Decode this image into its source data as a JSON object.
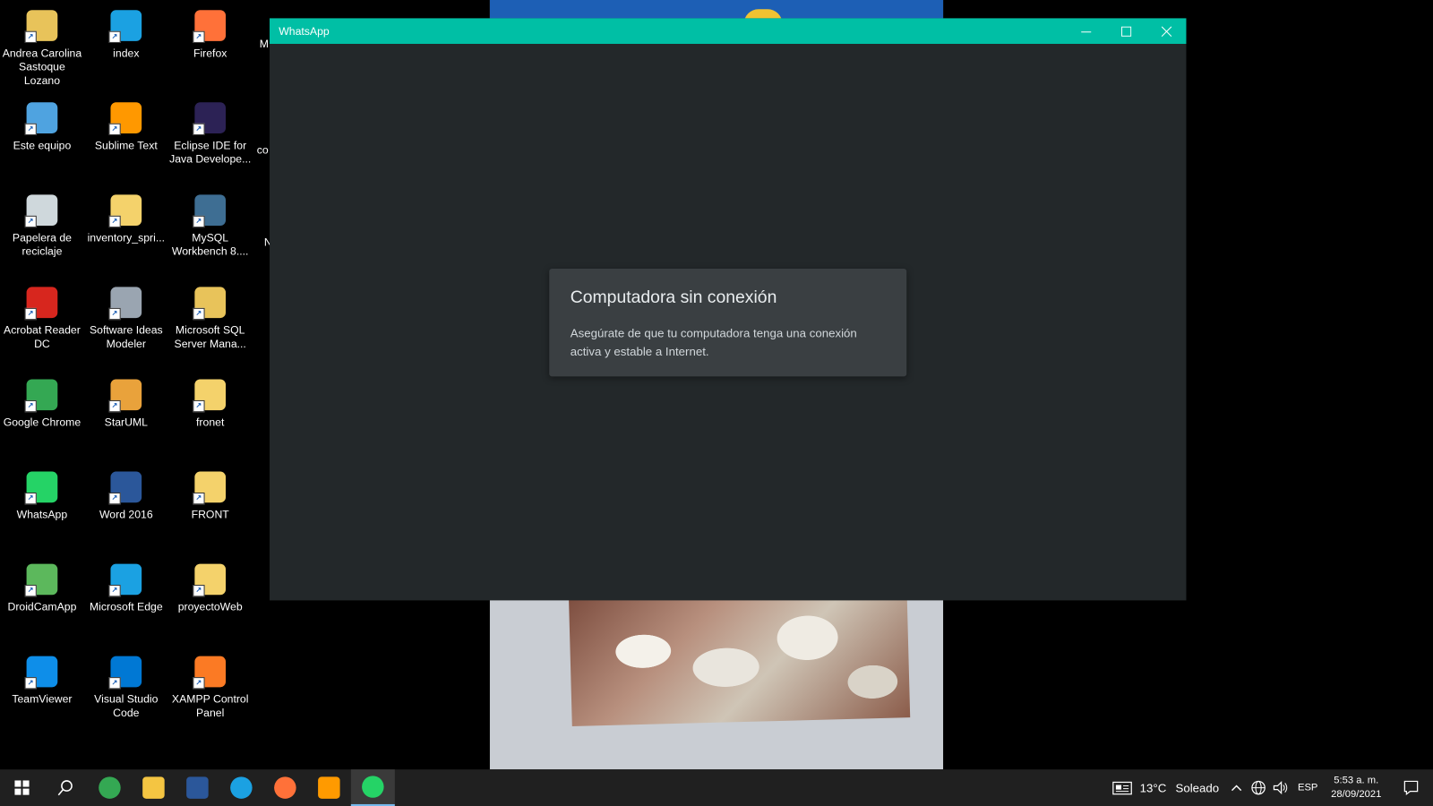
{
  "desktop": {
    "columns": [
      [
        {
          "label": "Andrea Carolina Sastoque Lozano",
          "icon": "user-folder-icon",
          "color": "#e8c35a"
        },
        {
          "label": "Este equipo",
          "icon": "computer-icon",
          "color": "#4fa3e0"
        },
        {
          "label": "Papelera de reciclaje",
          "icon": "recycle-bin-icon",
          "color": "#cfd8dc"
        },
        {
          "label": "Acrobat Reader DC",
          "icon": "acrobat-icon",
          "color": "#d7261e"
        },
        {
          "label": "Google Chrome",
          "icon": "chrome-icon",
          "color": "#34a853"
        },
        {
          "label": "WhatsApp",
          "icon": "whatsapp-icon",
          "color": "#25d366"
        },
        {
          "label": "DroidCamApp",
          "icon": "droidcam-icon",
          "color": "#5cb85c"
        },
        {
          "label": "TeamViewer",
          "icon": "teamviewer-icon",
          "color": "#0e8ee9"
        }
      ],
      [
        {
          "label": "index",
          "icon": "edge-icon",
          "color": "#1ba1e2"
        },
        {
          "label": "Sublime Text",
          "icon": "sublime-icon",
          "color": "#ff9800"
        },
        {
          "label": "inventory_spri...",
          "icon": "folder-icon",
          "color": "#f4d26b"
        },
        {
          "label": "Software Ideas Modeler",
          "icon": "modeler-icon",
          "color": "#9aa5b1"
        },
        {
          "label": "StarUML",
          "icon": "staruml-icon",
          "color": "#e9a23b"
        },
        {
          "label": "Word 2016",
          "icon": "word-icon",
          "color": "#2b579a"
        },
        {
          "label": "Microsoft Edge",
          "icon": "edge-icon",
          "color": "#1ba1e2"
        },
        {
          "label": "Visual Studio Code",
          "icon": "vscode-icon",
          "color": "#0078d4"
        }
      ],
      [
        {
          "label": "Firefox",
          "icon": "firefox-icon",
          "color": "#ff7139"
        },
        {
          "label": "Eclipse IDE for Java Develope...",
          "icon": "eclipse-icon",
          "color": "#2c2255"
        },
        {
          "label": "MySQL Workbench 8....",
          "icon": "mysql-icon",
          "color": "#3e6e93"
        },
        {
          "label": "Microsoft SQL Server Mana...",
          "icon": "sql-server-icon",
          "color": "#e8c35a"
        },
        {
          "label": "fronet",
          "icon": "vscode-folder-icon",
          "color": "#f4d26b"
        },
        {
          "label": "FRONT",
          "icon": "vscode-folder-icon",
          "color": "#f4d26b"
        },
        {
          "label": "proyectoWeb",
          "icon": "folder-icon",
          "color": "#f4d26b"
        },
        {
          "label": "XAMPP Control Panel",
          "icon": "xampp-icon",
          "color": "#fb7a24"
        }
      ]
    ],
    "partial_labels": [
      "M",
      "co",
      "N"
    ]
  },
  "whatsapp_window": {
    "title": "WhatsApp",
    "accent": "#00bfa5",
    "background": "#23282a",
    "offline_card": {
      "heading": "Computadora sin conexión",
      "message": "Asegúrate de que tu computadora tenga una conexión activa y estable a Internet."
    }
  },
  "taskbar": {
    "apps": [
      {
        "name": "chrome",
        "icon": "chrome-icon",
        "color": "#34a853"
      },
      {
        "name": "explorer",
        "icon": "folder-icon",
        "color": "#f4c542"
      },
      {
        "name": "word",
        "icon": "word-icon",
        "color": "#2b579a"
      },
      {
        "name": "edge",
        "icon": "edge-icon",
        "color": "#1ba1e2"
      },
      {
        "name": "firefox",
        "icon": "firefox-icon",
        "color": "#ff7139"
      },
      {
        "name": "illustrator",
        "icon": "illustrator-icon",
        "color": "#ff9a00"
      },
      {
        "name": "whatsapp",
        "icon": "whatsapp-icon",
        "color": "#25d366"
      }
    ],
    "weather": "13°C",
    "weather_condition": "Soleado",
    "language": "ESP",
    "time": "5:53 a. m.",
    "date": "28/09/2021"
  }
}
